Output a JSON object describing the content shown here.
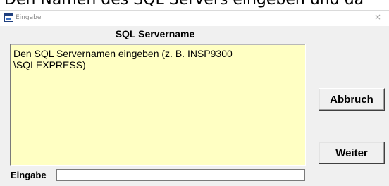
{
  "background_text": "Den Namen des SQL Servers eingeben und da",
  "window": {
    "title": "Eingabe",
    "close_symbol": "×"
  },
  "dialog": {
    "heading": "SQL Servername",
    "message": "Den SQL Servernamen eingeben (z. B. INSP9300 \\SQLEXPRESS)",
    "message_bg_color": "#ffffc3"
  },
  "buttons": {
    "cancel_label": "Abbruch",
    "next_label": "Weiter"
  },
  "input": {
    "label": "Eingabe",
    "value": ""
  },
  "icons": {
    "window_icon": "window-app-icon",
    "close": "close-icon"
  }
}
